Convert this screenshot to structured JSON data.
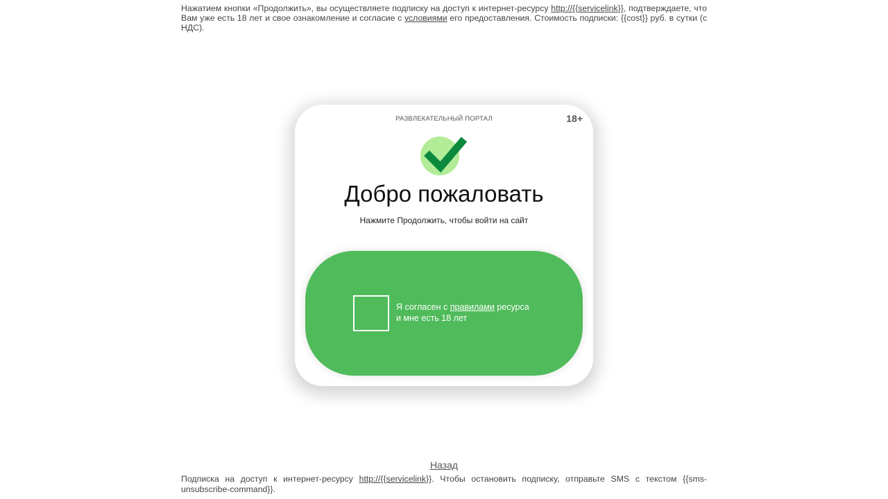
{
  "top_disclaimer": {
    "part1": "Нажатием кнопки «Продолжить», вы осуществляете подписку на доступ к интернет-ресурсу ",
    "service_link": "http://{{servicelink}}",
    "part2": ", подтверждаете, что Вам уже есть 18 лет и свое ознакомление и согласие с ",
    "terms_link": "условиями",
    "part3": " его предоставления. Стоимость подписки: {{cost}} руб. в сутки (с НДС)."
  },
  "card": {
    "portal_label": "РАЗВЛЕКАТЕЛЬНЫЙ ПОРТАЛ",
    "age_badge": "18+",
    "title": "Добро пожаловать",
    "subtitle": "Нажмите Продолжить, чтобы войти на сайт",
    "check_icon": "checkmark-icon",
    "agree": {
      "prefix": "Я согласен с ",
      "rules_link": "правилами",
      "suffix_line1": " ресурса",
      "line2": "и мне есть 18 лет",
      "checked": false
    }
  },
  "back_link": "Назад",
  "bottom_note": {
    "part1": "Подписка на доступ к интернет-ресурсу ",
    "service_link": "http://{{servicelink}}",
    "part2": ". Чтобы остановить подписку, отправьте SMS с текстом {{sms-unsubscribe-command}}."
  },
  "colors": {
    "button_green": "#50bb5b",
    "check_dark": "#0b8a3e",
    "check_light": "#b2ec97",
    "text_gray": "#444444"
  }
}
